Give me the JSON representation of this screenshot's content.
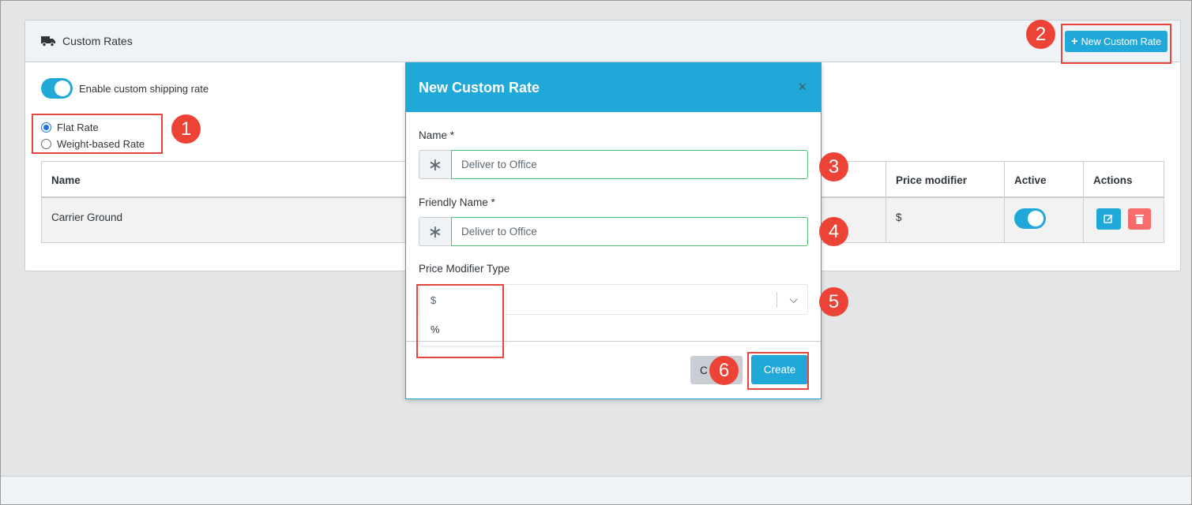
{
  "card": {
    "title": "Custom Rates",
    "new_button_label": "New Custom Rate",
    "toggle_label": "Enable custom shipping rate",
    "radio_options": [
      {
        "label": "Flat Rate",
        "checked": true
      },
      {
        "label": "Weight-based Rate",
        "checked": false
      }
    ]
  },
  "table": {
    "headers": {
      "name": "Name",
      "price_modifier": "Price modifier",
      "active": "Active",
      "actions": "Actions"
    },
    "rows": [
      {
        "name": "Carrier Ground",
        "price_modifier": "$",
        "active": true
      }
    ]
  },
  "modal": {
    "title": "New Custom Rate",
    "close_glyph": "×",
    "name_label": "Name *",
    "name_value": "Deliver to Office",
    "friendly_label": "Friendly Name *",
    "friendly_value": "Deliver to Office",
    "price_type_label": "Price Modifier Type",
    "price_type_options": [
      "$",
      "%"
    ],
    "cancel_label": "C",
    "create_label": "Create"
  },
  "annotations": {
    "badges": [
      "1",
      "2",
      "3",
      "4",
      "5",
      "6"
    ]
  },
  "colors": {
    "accent": "#20a8d8",
    "danger": "#f86c6b",
    "annotation": "#ec4336",
    "valid_border": "#4dbd74"
  },
  "icons": {
    "header": "truck-icon",
    "plus": "plus-icon",
    "edit": "edit-icon",
    "delete": "trash-icon",
    "required": "asterisk-icon",
    "select": "chevron-down-icon"
  }
}
